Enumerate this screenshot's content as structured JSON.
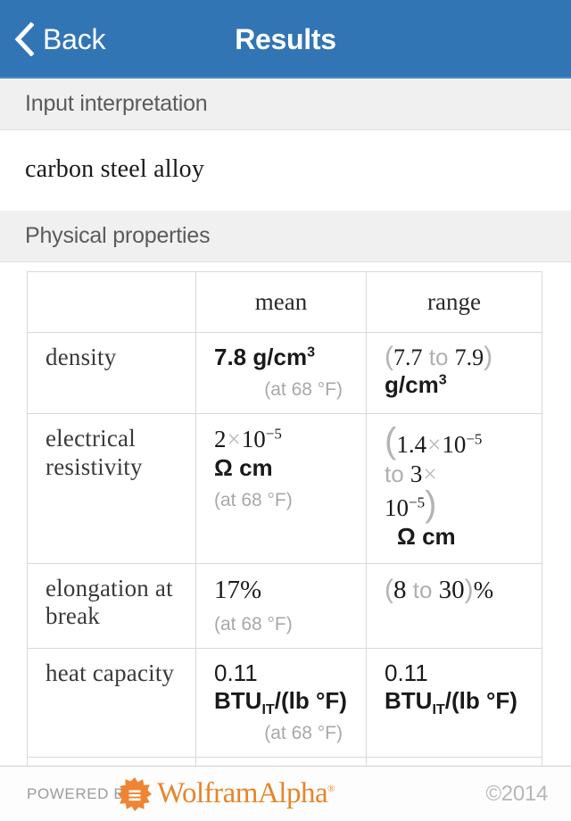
{
  "navbar": {
    "back_label": "Back",
    "title": "Results",
    "back_icon": "chevron-left-icon",
    "bg_color": "#3275b5"
  },
  "sections": [
    {
      "id": "input-interpretation",
      "title": "Input interpretation",
      "content": "carbon steel alloy"
    },
    {
      "id": "physical-properties",
      "title": "Physical properties"
    }
  ],
  "table": {
    "headers": [
      "",
      "mean",
      "range"
    ],
    "rows": [
      {
        "label": "density",
        "mean": {
          "value": "7.8",
          "unit": "g/cm",
          "exp": "3",
          "condition": "(at 68 °F)"
        },
        "range": {
          "low": "7.7",
          "to": "to",
          "high": "7.9",
          "unit": "g/cm",
          "exp": "3"
        }
      },
      {
        "label": "electrical resistivity",
        "mean": {
          "value": "2",
          "times": "×",
          "base": "10",
          "exp": "−5",
          "unit": "Ω cm",
          "condition": "(at 68 °F)"
        },
        "range": {
          "low": "1.4",
          "low_base": "10",
          "low_exp": "−5",
          "to": "to",
          "high": "3",
          "high_base": "10",
          "high_exp": "−5",
          "unit": "Ω cm",
          "times": "×"
        }
      },
      {
        "label": "elongation at break",
        "mean": {
          "value": "17%",
          "condition": "(at 68 °F)"
        },
        "range": {
          "low": "8",
          "to": "to",
          "high": "30",
          "unit": "%"
        }
      },
      {
        "label": "heat capacity",
        "mean": {
          "value": "0.11",
          "unit_main": "BTU",
          "unit_sub": "IT",
          "unit_tail": "/(lb °F)",
          "condition": "(at 68 °F)"
        },
        "range": {
          "value": "0.11",
          "unit_main": "BTU",
          "unit_sub": "IT",
          "unit_tail": "/(lb °F)"
        }
      }
    ]
  },
  "footer": {
    "powered_by": "POWERED BY",
    "brand": "WolframAlpha",
    "registered": "®",
    "copyright": "©2014",
    "brand_color": "#e8842a"
  }
}
